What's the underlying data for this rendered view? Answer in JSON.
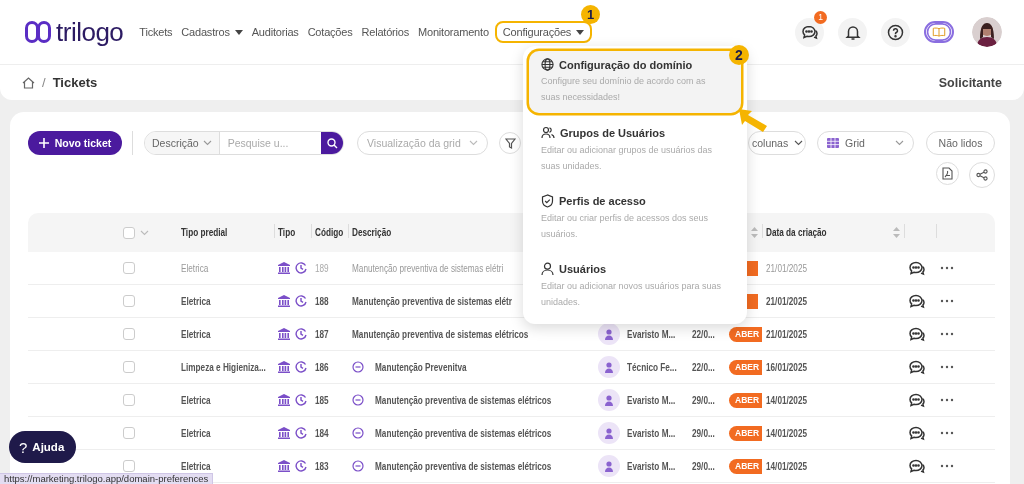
{
  "nav": {
    "logo": "trilogo",
    "items": [
      {
        "label": "Tickets",
        "dropdown": false
      },
      {
        "label": "Cadastros",
        "dropdown": true
      },
      {
        "label": "Auditorias",
        "dropdown": false
      },
      {
        "label": "Cotações",
        "dropdown": false
      },
      {
        "label": "Relatórios",
        "dropdown": false
      },
      {
        "label": "Monitoramento",
        "dropdown": false
      },
      {
        "label": "Configurações",
        "dropdown": true,
        "annotation": "1"
      }
    ],
    "chat_badge": "1"
  },
  "breadcrumb": {
    "separator": "/",
    "current": "Tickets",
    "role": "Solicitante"
  },
  "toolbar": {
    "new_button": "Novo ticket",
    "search": {
      "field": "Descrição",
      "placeholder": "Pesquise u..."
    },
    "view_select": {
      "placeholder": "Visualização da grid"
    },
    "columns_select": {
      "label": "colunas"
    },
    "layout_select": {
      "label": "Grid"
    },
    "unread_button": "Não lidos"
  },
  "table": {
    "select_all_checked": false,
    "columns": [
      "Tipo predial",
      "Tipo",
      "Código",
      "Descrição",
      "Data da criação"
    ],
    "rows": [
      {
        "type": "Eletrica",
        "code": "189",
        "description": "Manutenção preventiva de sistemas elétri",
        "unread": false,
        "chat": false,
        "checked": false,
        "badge": true,
        "created": "21/01/2025"
      },
      {
        "type": "Eletrica",
        "code": "188",
        "description": "Manutenção preventiva de sistemas elétr",
        "unread": true,
        "chat": false,
        "checked": false,
        "badge": true,
        "created": "21/01/2025"
      },
      {
        "type": "Eletrica",
        "code": "187",
        "description": "Manutenção preventiva de sistemas elétricos",
        "unread": true,
        "chat": false,
        "checked": false,
        "badge": true,
        "responsible": "Evaristo M...",
        "deadline": "22/0...",
        "status": "ABER",
        "created": "21/01/2025"
      },
      {
        "type": "Limpeza e Higieniza...",
        "code": "186",
        "description": "Manutenção Prevenitva",
        "unread": true,
        "chat": true,
        "checked": false,
        "badge": true,
        "responsible": "Técnico Fe...",
        "deadline": "22/0...",
        "status": "ABER",
        "created": "16/01/2025"
      },
      {
        "type": "Eletrica",
        "code": "185",
        "description": "Manutenção preventiva de sistemas elétricos",
        "unread": true,
        "chat": true,
        "checked": false,
        "badge": true,
        "responsible": "Evaristo M...",
        "deadline": "29/0...",
        "status": "ABER",
        "created": "14/01/2025"
      },
      {
        "type": "Eletrica",
        "code": "184",
        "description": "Manutenção preventiva de sistemas elétricos",
        "unread": true,
        "chat": true,
        "checked": false,
        "badge": true,
        "responsible": "Evaristo M...",
        "deadline": "29/0...",
        "status": "ABER",
        "created": "14/01/2025"
      },
      {
        "type": "Eletrica",
        "code": "183",
        "description": "Manutenção preventiva de sistemas elétricos",
        "unread": true,
        "chat": true,
        "checked": false,
        "badge": true,
        "responsible": "Evaristo M...",
        "deadline": "29/0...",
        "status": "ABER",
        "created": "14/01/2025"
      }
    ]
  },
  "menu": {
    "items": [
      {
        "kind": "globe",
        "title": "Configuração do domínio",
        "description": "Configure seu domínio de acordo com as suas necessidades!",
        "selected": true,
        "annotation": "2"
      },
      {
        "kind": "users",
        "title": "Grupos de Usuários",
        "description": "Editar ou adicionar grupos de usuários das suas unidades.",
        "selected": false
      },
      {
        "kind": "shield",
        "title": "Perfis de acesso",
        "description": "Editar ou criar perfis de acessos dos seus usuários.",
        "selected": false
      },
      {
        "kind": "user",
        "title": "Usuários",
        "description": "Editar ou adicionar novos usuários para suas unidades.",
        "selected": false
      }
    ]
  },
  "help_button": {
    "icon": "?",
    "label": "Ajuda"
  },
  "status_url": "https://marketing.trilogo.app/domain-preferences"
}
